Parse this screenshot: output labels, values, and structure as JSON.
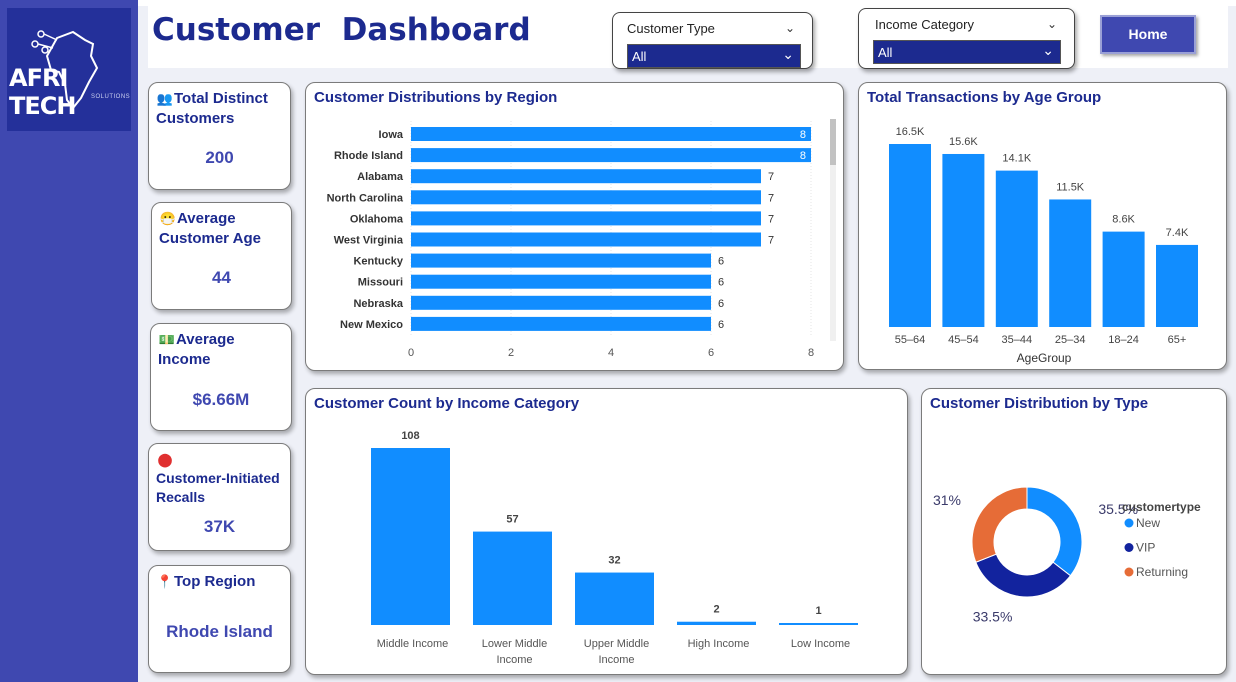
{
  "brand": {
    "logo_text": "AFRI TECH",
    "logo_sub": "SOLUTIONS"
  },
  "header": {
    "title": "Customer  Dashboard",
    "home_button": "Home"
  },
  "slicers": {
    "customer_type": {
      "label": "Customer Type",
      "value": "All"
    },
    "income_category": {
      "label": "Income Category",
      "value": "All"
    }
  },
  "kpis": {
    "total_customers": {
      "title": "Total Distinct Customers",
      "value": "200",
      "icon": "people-icon"
    },
    "avg_age": {
      "title": "Average Customer Age",
      "value": "44",
      "icon": "face-icon"
    },
    "avg_income": {
      "title": "Average Income",
      "value": "$6.66M",
      "icon": "money-icon"
    },
    "recalls": {
      "title": "Customer-Initiated Recalls",
      "value": "37K",
      "icon": "stop-icon"
    },
    "top_region": {
      "title": "Top Region",
      "value": "Rhode Island",
      "icon": "pin-icon"
    }
  },
  "colors": {
    "bar": "#118dff",
    "new": "#118dff",
    "vip": "#12239e",
    "returning": "#e66c37",
    "title": "#1c2a8f"
  },
  "chart_data": [
    {
      "id": "region",
      "type": "bar",
      "orientation": "horizontal",
      "title": "Customer Distributions by Region",
      "categories": [
        "Iowa",
        "Rhode Island",
        "Alabama",
        "North Carolina",
        "Oklahoma",
        "West Virginia",
        "Kentucky",
        "Missouri",
        "Nebraska",
        "New Mexico"
      ],
      "values": [
        8,
        8,
        7,
        7,
        7,
        7,
        6,
        6,
        6,
        6
      ],
      "xlim": [
        0,
        8
      ],
      "xticks": [
        0,
        2,
        4,
        6,
        8
      ]
    },
    {
      "id": "age",
      "type": "bar",
      "title": "Total Transactions by Age Group",
      "xlabel": "AgeGroup",
      "categories": [
        "55–64",
        "45–54",
        "35–44",
        "25–34",
        "18–24",
        "65+"
      ],
      "values": [
        16500,
        15600,
        14100,
        11500,
        8600,
        7400
      ],
      "labels": [
        "16.5K",
        "15.6K",
        "14.1K",
        "11.5K",
        "8.6K",
        "7.4K"
      ],
      "ylim": [
        0,
        16500
      ]
    },
    {
      "id": "income",
      "type": "bar",
      "title": "Customer Count by Income Category",
      "categories": [
        "Middle Income",
        "Lower Middle Income",
        "Upper Middle Income",
        "High Income",
        "Low Income"
      ],
      "values": [
        108,
        57,
        32,
        2,
        1
      ],
      "ylim": [
        0,
        108
      ]
    },
    {
      "id": "type",
      "type": "pie",
      "title": "Customer Distribution by Type",
      "legend_title": "customertype",
      "legend_placement": "right",
      "slices": [
        {
          "name": "New",
          "value": 35.5,
          "label": "35.5%"
        },
        {
          "name": "VIP",
          "value": 33.5,
          "label": "33.5%"
        },
        {
          "name": "Returning",
          "value": 31,
          "label": "31%"
        }
      ]
    }
  ]
}
